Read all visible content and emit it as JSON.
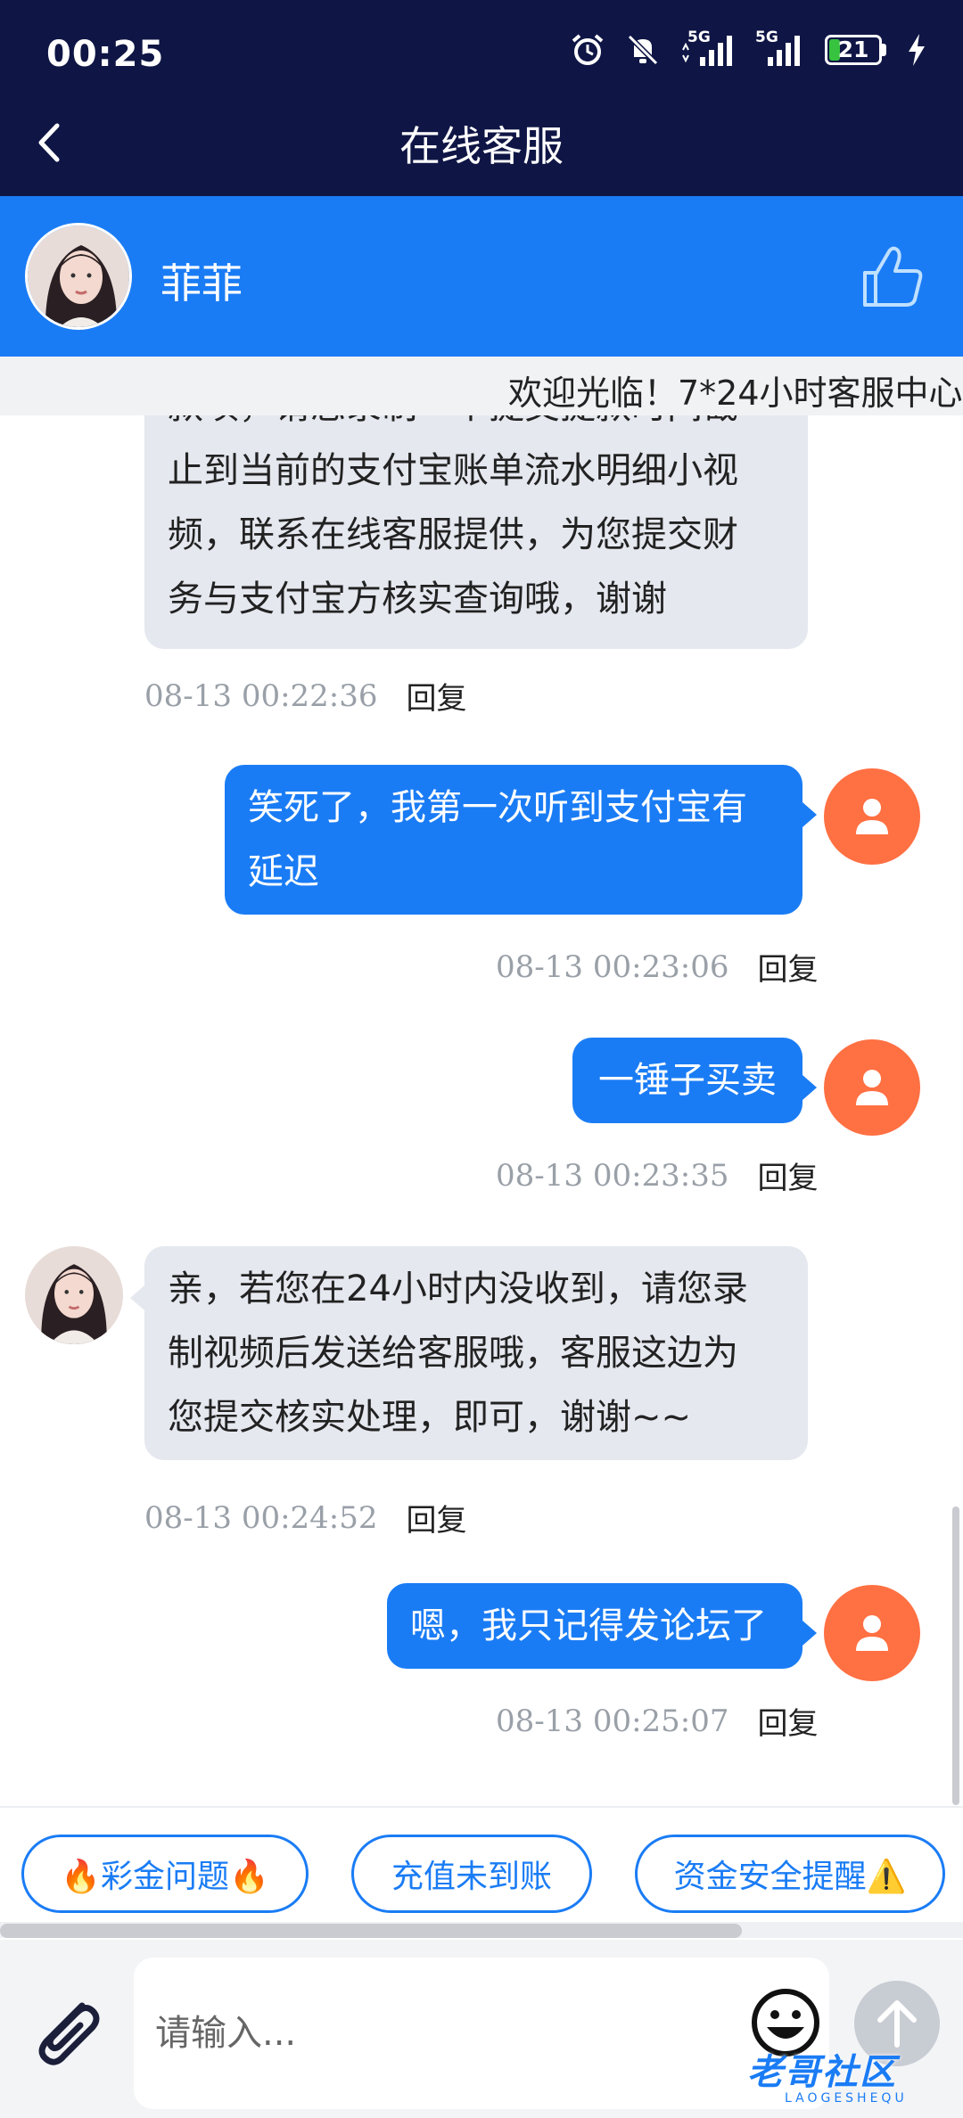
{
  "status_bar": {
    "time": "00:25",
    "network_1": "5G",
    "network_2": "5G",
    "battery": "21",
    "battery_level": 0.21
  },
  "header": {
    "title": "在线客服"
  },
  "agent": {
    "name": "菲菲"
  },
  "notice": {
    "text": "欢迎光临！7*24小时客服中心"
  },
  "messages": [
    {
      "from": "agent",
      "lines": [
        "款项，请您录制一个提交提款时间截",
        "止到当前的支付宝账单流水明细小视",
        "频，联系在线客服提供，为您提交财",
        "务与支付宝方核实查询哦，谢谢"
      ],
      "time": "08-13 00:22:36",
      "reply": "回复"
    },
    {
      "from": "user",
      "lines": [
        "笑死了，我第一次听到支付宝有",
        "延迟"
      ],
      "time": "08-13 00:23:06",
      "reply": "回复"
    },
    {
      "from": "user",
      "lines": [
        "一锤子买卖"
      ],
      "time": "08-13 00:23:35",
      "reply": "回复"
    },
    {
      "from": "agent",
      "lines": [
        "亲，若您在24小时内没收到，请您录",
        "制视频后发送给客服哦，客服这边为",
        "您提交核实处理，即可，谢谢~~"
      ],
      "time": "08-13 00:24:52",
      "reply": "回复"
    },
    {
      "from": "user",
      "lines": [
        "嗯，我只记得发论坛了"
      ],
      "time": "08-13 00:25:07",
      "reply": "回复"
    }
  ],
  "quick_replies": [
    "🔥彩金问题🔥",
    "充值未到账",
    "资金安全提醒⚠️"
  ],
  "input": {
    "placeholder": "请输入..."
  },
  "watermark": {
    "text": "老哥社区",
    "sub": "LAOGESHEQU"
  },
  "colors": {
    "top_bar": "#0f1645",
    "accent": "#1a7cf5",
    "user_avatar": "#ff7043",
    "agent_bubble": "#e5e8ef"
  }
}
